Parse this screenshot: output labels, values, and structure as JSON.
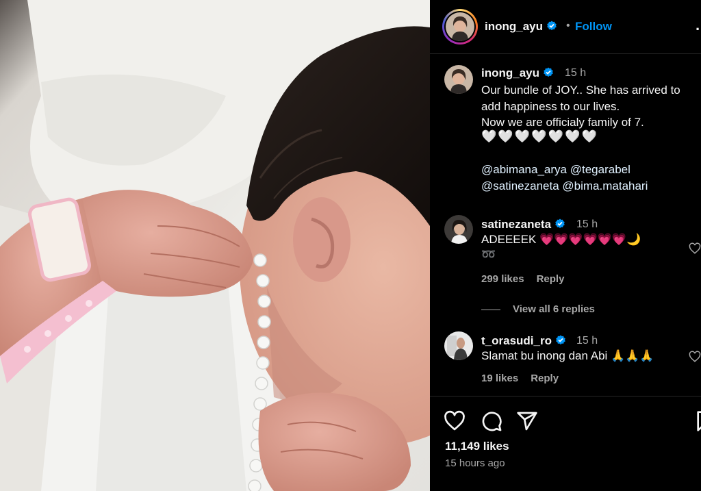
{
  "post": {
    "username": "inong_ayu",
    "follow_label": "Follow",
    "header_separator": "•",
    "more_label": "...",
    "photo_alt": "newborn baby photo"
  },
  "caption": {
    "username": "inong_ayu",
    "time": "15 h",
    "lines": [
      "Our bundle of JOY.. She has arrived to",
      "add happiness to our lives.",
      "Now we are officialy family of 7."
    ],
    "hearts": "🤍🤍🤍🤍🤍🤍🤍",
    "mentions": [
      "@abimana_arya",
      "@tegarabel",
      "@satinezaneta",
      "@bima.matahari"
    ]
  },
  "comments": [
    {
      "username": "satinezaneta",
      "time": "15 h",
      "text": "ADEEEEK 💗💗💗💗💗💗🌙",
      "text_line2": "➿",
      "likes": "299 likes",
      "reply": "Reply"
    },
    {
      "username": "t_orasudi_ro",
      "time": "15 h",
      "text": "Slamat bu inong dan Abi 🙏🙏🙏",
      "likes": "19 likes",
      "reply": "Reply"
    }
  ],
  "view_replies": "View all 6 replies",
  "footer": {
    "likes": "11,149 likes",
    "posted": "15 hours ago"
  },
  "icons": {
    "verified": "verified-badge-icon",
    "like": "heart-icon",
    "comment": "comment-icon",
    "share": "share-icon",
    "save": "bookmark-icon"
  },
  "colors": {
    "background": "#000000",
    "accent": "#0095f6",
    "secondary_text": "#a8a8a8",
    "divider": "#262626"
  }
}
